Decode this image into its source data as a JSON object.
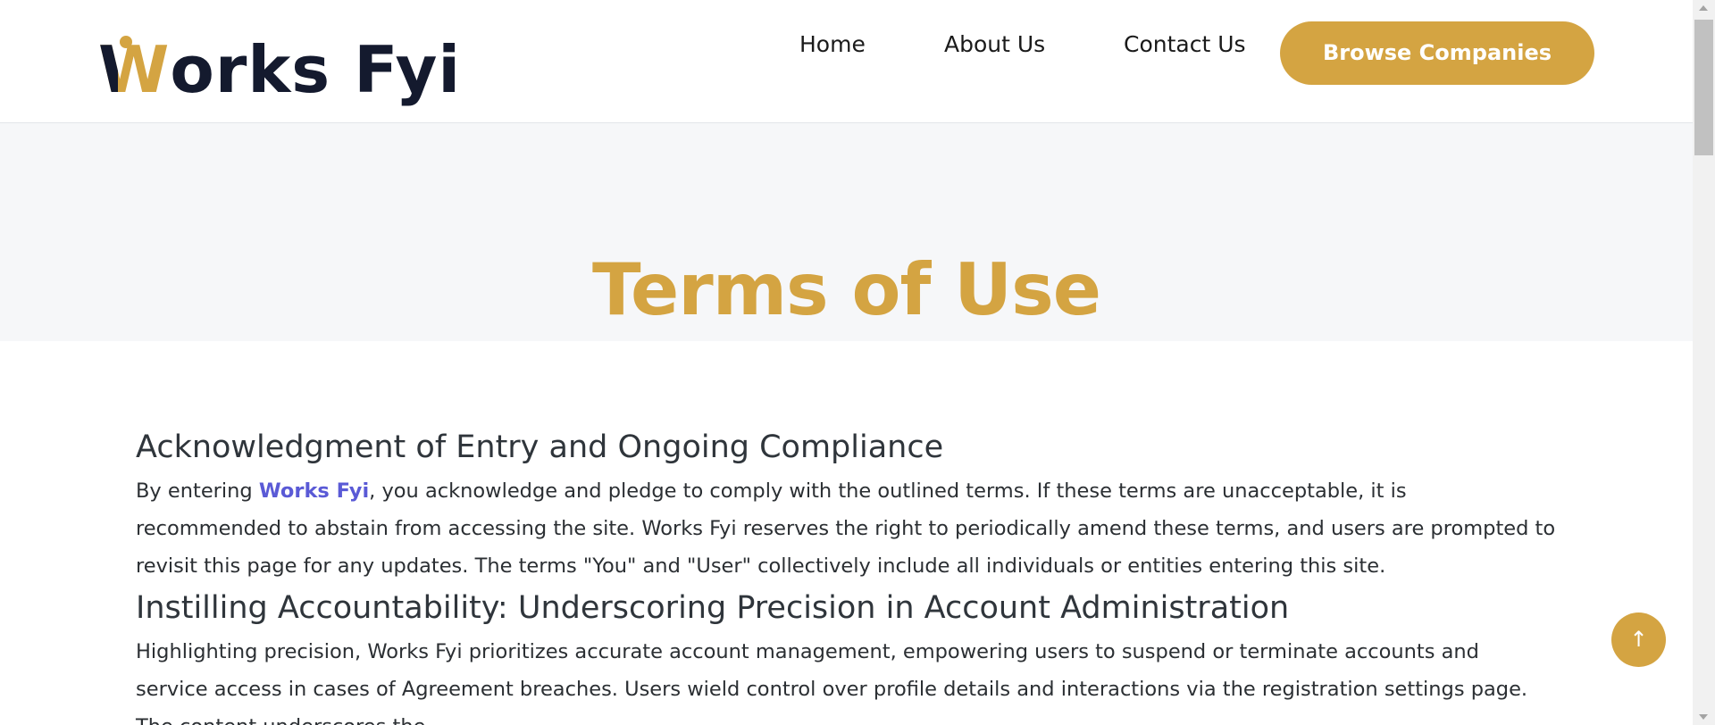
{
  "header": {
    "logo_text": "Works Fyi",
    "nav": {
      "home": "Home",
      "about": "About Us",
      "contact": "Contact Us"
    },
    "cta_label": "Browse Companies"
  },
  "hero": {
    "title": "Terms of Use"
  },
  "sections": [
    {
      "heading": "Acknowledgment of Entry and Ongoing Compliance",
      "text_before": "By entering ",
      "link": "Works Fyi",
      "text_after": ", you acknowledge and pledge to comply with the outlined terms. If these terms are unacceptable, it is recommended to abstain from accessing the site. Works Fyi reserves the right to periodically amend these terms, and users are prompted to revisit this page for any updates. The terms \"You\" and \"User\" collectively include all individuals or entities entering this site."
    },
    {
      "heading": "Instilling Accountability: Underscoring Precision in Account Administration",
      "text": "Highlighting precision, Works Fyi prioritizes accurate account management, empowering users to suspend or terminate accounts and service access in cases of Agreement breaches. Users wield control over profile details and interactions via the registration settings page. The content underscores the"
    }
  ],
  "back_to_top": {
    "glyph": "↑",
    "icon": "arrow-up-icon"
  },
  "colors": {
    "brand_gold": "#d4a442",
    "brand_navy": "#141a2e",
    "link_blue": "#5a5ad6",
    "hero_bg": "#f6f7f9"
  }
}
